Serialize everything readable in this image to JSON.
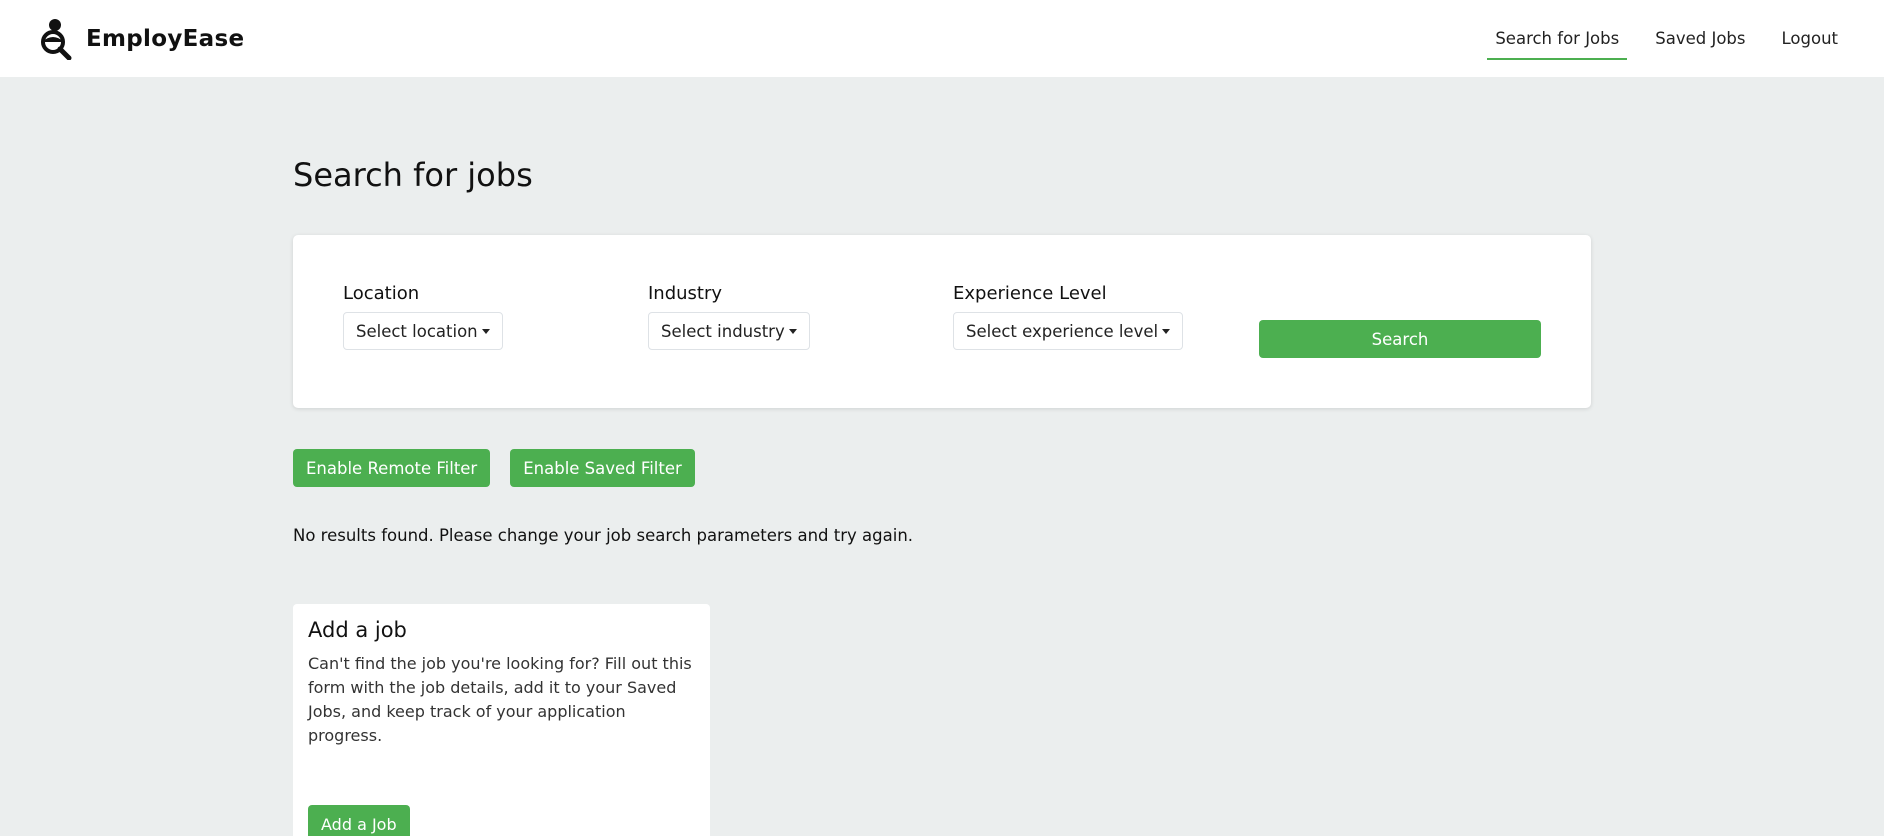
{
  "brand": {
    "name": "EmployEase",
    "logo_icon": "person-search-icon"
  },
  "nav": {
    "items": [
      {
        "label": "Search for Jobs",
        "active": true
      },
      {
        "label": "Saved Jobs",
        "active": false
      },
      {
        "label": "Logout",
        "active": false
      }
    ],
    "accent_color": "#4caf50"
  },
  "page": {
    "title": "Search for jobs"
  },
  "filters": {
    "location": {
      "label": "Location",
      "selected": "Select location"
    },
    "industry": {
      "label": "Industry",
      "selected": "Select industry"
    },
    "experience": {
      "label": "Experience Level",
      "selected": "Select experience level"
    },
    "search_label": "Search"
  },
  "toggles": {
    "remote_label": "Enable Remote Filter",
    "saved_label": "Enable Saved Filter"
  },
  "results": {
    "message": "No results found. Please change your job search parameters and try again."
  },
  "add_job": {
    "title": "Add a job",
    "description": "Can't find the job you're looking for? Fill out this form with the job details, add it to your Saved Jobs, and keep track of your application progress.",
    "button_label": "Add a Job"
  },
  "colors": {
    "background": "#ebeeee",
    "primary": "#4caf50",
    "surface": "#ffffff"
  }
}
